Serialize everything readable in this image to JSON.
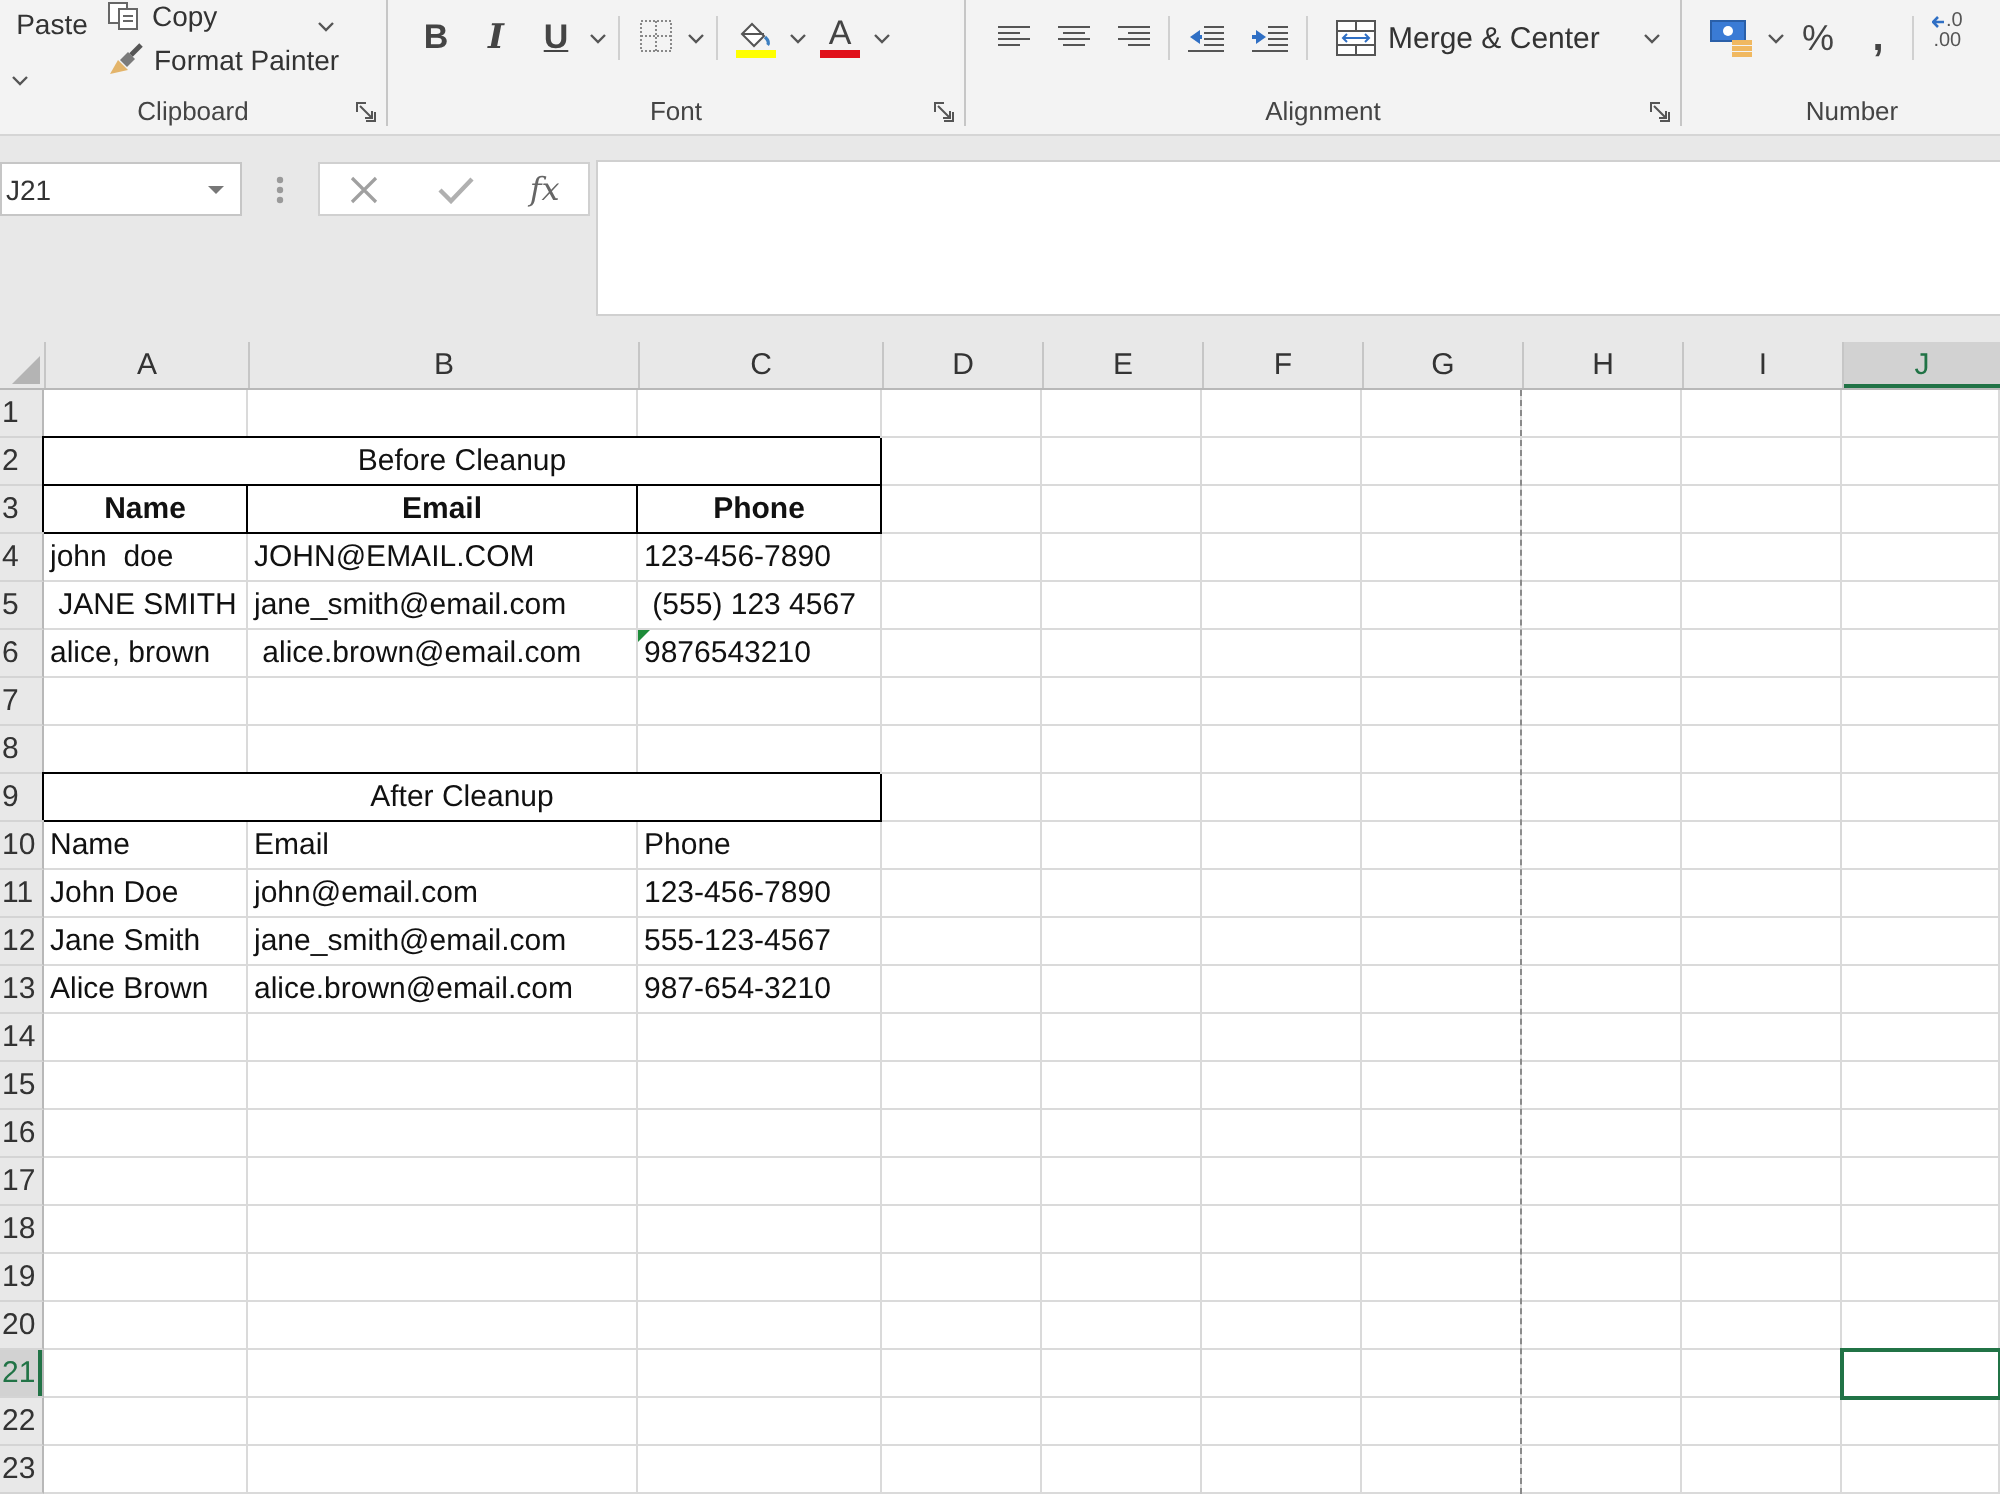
{
  "ribbon": {
    "clipboard": {
      "label": "Clipboard",
      "paste": "Paste",
      "copy": "Copy",
      "format_painter": "Format Painter"
    },
    "font": {
      "label": "Font",
      "bold": "B",
      "italic": "I",
      "underline": "U",
      "font_color": "A"
    },
    "alignment": {
      "label": "Alignment",
      "merge": "Merge & Center"
    },
    "number": {
      "label": "Number",
      "percent": "%",
      "comma": ",",
      "decimal_top": ".0",
      "decimal_bottom": ".00"
    }
  },
  "formula_bar": {
    "name_box": "J21",
    "function_button": "fx"
  },
  "sheet": {
    "columns": [
      {
        "label": "A",
        "selected": false,
        "page_break": false
      },
      {
        "label": "B",
        "selected": false,
        "page_break": false
      },
      {
        "label": "C",
        "selected": false,
        "page_break": false
      },
      {
        "label": "D",
        "selected": false,
        "page_break": false
      },
      {
        "label": "E",
        "selected": false,
        "page_break": false
      },
      {
        "label": "F",
        "selected": false,
        "page_break": false
      },
      {
        "label": "G",
        "selected": false,
        "page_break": true
      },
      {
        "label": "H",
        "selected": false,
        "page_break": false
      },
      {
        "label": "I",
        "selected": false,
        "page_break": false
      },
      {
        "label": "J",
        "selected": true,
        "page_break": false
      }
    ],
    "rows": [
      {
        "label": "1",
        "selected": false,
        "kind": "empty"
      },
      {
        "label": "2",
        "selected": false,
        "kind": "title",
        "text": "Before Cleanup"
      },
      {
        "label": "3",
        "selected": false,
        "kind": "header",
        "cells": [
          "Name",
          "Email",
          "Phone"
        ]
      },
      {
        "label": "4",
        "selected": false,
        "kind": "data",
        "cells": [
          {
            "text": "john  doe",
            "flagged": false
          },
          {
            "text": "JOHN@EMAIL.COM",
            "flagged": false
          },
          {
            "text": "123-456-7890",
            "flagged": false
          }
        ]
      },
      {
        "label": "5",
        "selected": false,
        "kind": "data",
        "cells": [
          {
            "text": " JANE SMITH",
            "flagged": false
          },
          {
            "text": "jane_smith@email.com",
            "flagged": false
          },
          {
            "text": " (555) 123 4567",
            "flagged": false
          }
        ]
      },
      {
        "label": "6",
        "selected": false,
        "kind": "data",
        "cells": [
          {
            "text": "alice, brown",
            "flagged": false
          },
          {
            "text": " alice.brown@email.com",
            "flagged": false
          },
          {
            "text": "9876543210",
            "flagged": true
          }
        ]
      },
      {
        "label": "7",
        "selected": false,
        "kind": "empty"
      },
      {
        "label": "8",
        "selected": false,
        "kind": "empty"
      },
      {
        "label": "9",
        "selected": false,
        "kind": "title",
        "text": "After Cleanup"
      },
      {
        "label": "10",
        "selected": false,
        "kind": "data",
        "cells": [
          {
            "text": "Name",
            "flagged": false
          },
          {
            "text": "Email",
            "flagged": false
          },
          {
            "text": "Phone",
            "flagged": false
          }
        ]
      },
      {
        "label": "11",
        "selected": false,
        "kind": "data",
        "cells": [
          {
            "text": "John Doe",
            "flagged": false
          },
          {
            "text": "john@email.com",
            "flagged": false
          },
          {
            "text": "123-456-7890",
            "flagged": false
          }
        ]
      },
      {
        "label": "12",
        "selected": false,
        "kind": "data",
        "cells": [
          {
            "text": "Jane Smith",
            "flagged": false
          },
          {
            "text": "jane_smith@email.com",
            "flagged": false
          },
          {
            "text": "555-123-4567",
            "flagged": false
          }
        ]
      },
      {
        "label": "13",
        "selected": false,
        "kind": "data",
        "cells": [
          {
            "text": "Alice Brown",
            "flagged": false
          },
          {
            "text": "alice.brown@email.com",
            "flagged": false
          },
          {
            "text": "987-654-3210",
            "flagged": false
          }
        ]
      },
      {
        "label": "14",
        "selected": false,
        "kind": "empty"
      },
      {
        "label": "15",
        "selected": false,
        "kind": "empty"
      },
      {
        "label": "16",
        "selected": false,
        "kind": "empty"
      },
      {
        "label": "17",
        "selected": false,
        "kind": "empty"
      },
      {
        "label": "18",
        "selected": false,
        "kind": "empty"
      },
      {
        "label": "19",
        "selected": false,
        "kind": "empty"
      },
      {
        "label": "20",
        "selected": false,
        "kind": "empty"
      },
      {
        "label": "21",
        "selected": true,
        "kind": "empty"
      },
      {
        "label": "22",
        "selected": false,
        "kind": "empty"
      },
      {
        "label": "23",
        "selected": false,
        "kind": "empty"
      }
    ]
  }
}
